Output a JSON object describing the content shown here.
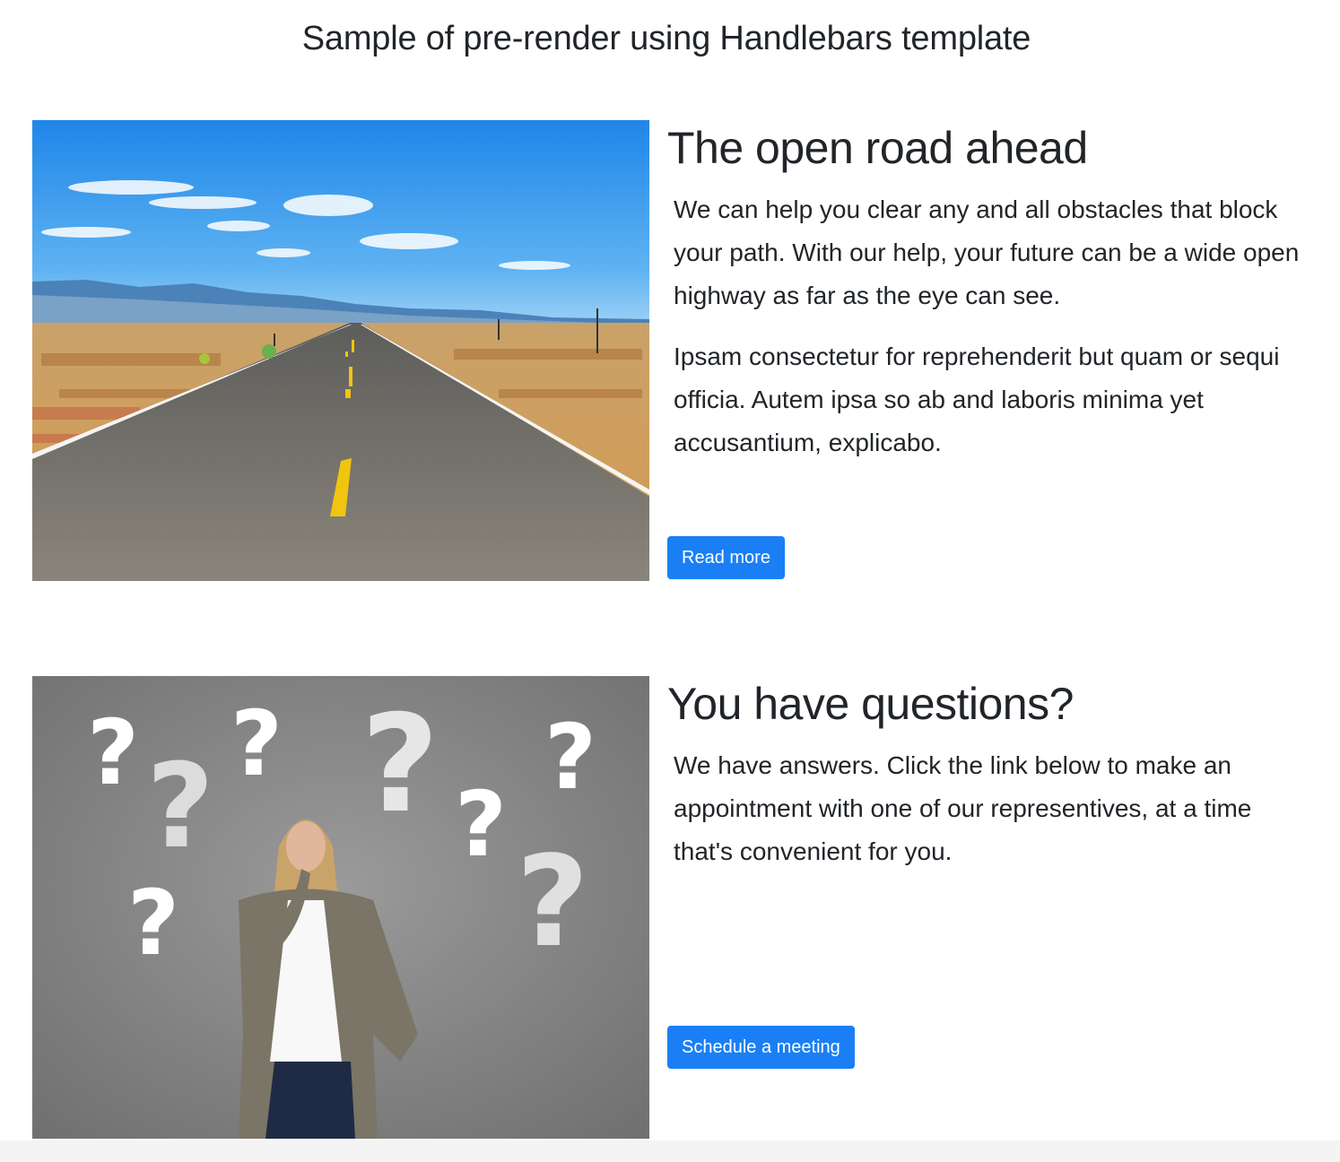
{
  "page": {
    "title": "Sample of pre-render using Handlebars template"
  },
  "cards": [
    {
      "image_alt": "straight desert highway under blue sky",
      "heading": "The open road ahead",
      "paragraphs": [
        "We can help you clear any and all obstacles that block your path. With our help, your future can be a wide open highway as far as the eye can see.",
        "Ipsam consectetur for reprehenderit but quam or sequi officia. Autem ipsa so ab and laboris minima yet accusantium, explicabo."
      ],
      "button_label": "Read more"
    },
    {
      "image_alt": "woman thinking surrounded by question marks",
      "heading": "You have questions?",
      "paragraphs": [
        "We have answers. Click the link below to make an appointment with one of our representives, at a time that's convenient for you."
      ],
      "button_label": "Schedule a meeting"
    }
  ],
  "colors": {
    "primary_button": "#1a7ff5",
    "text": "#212529"
  }
}
